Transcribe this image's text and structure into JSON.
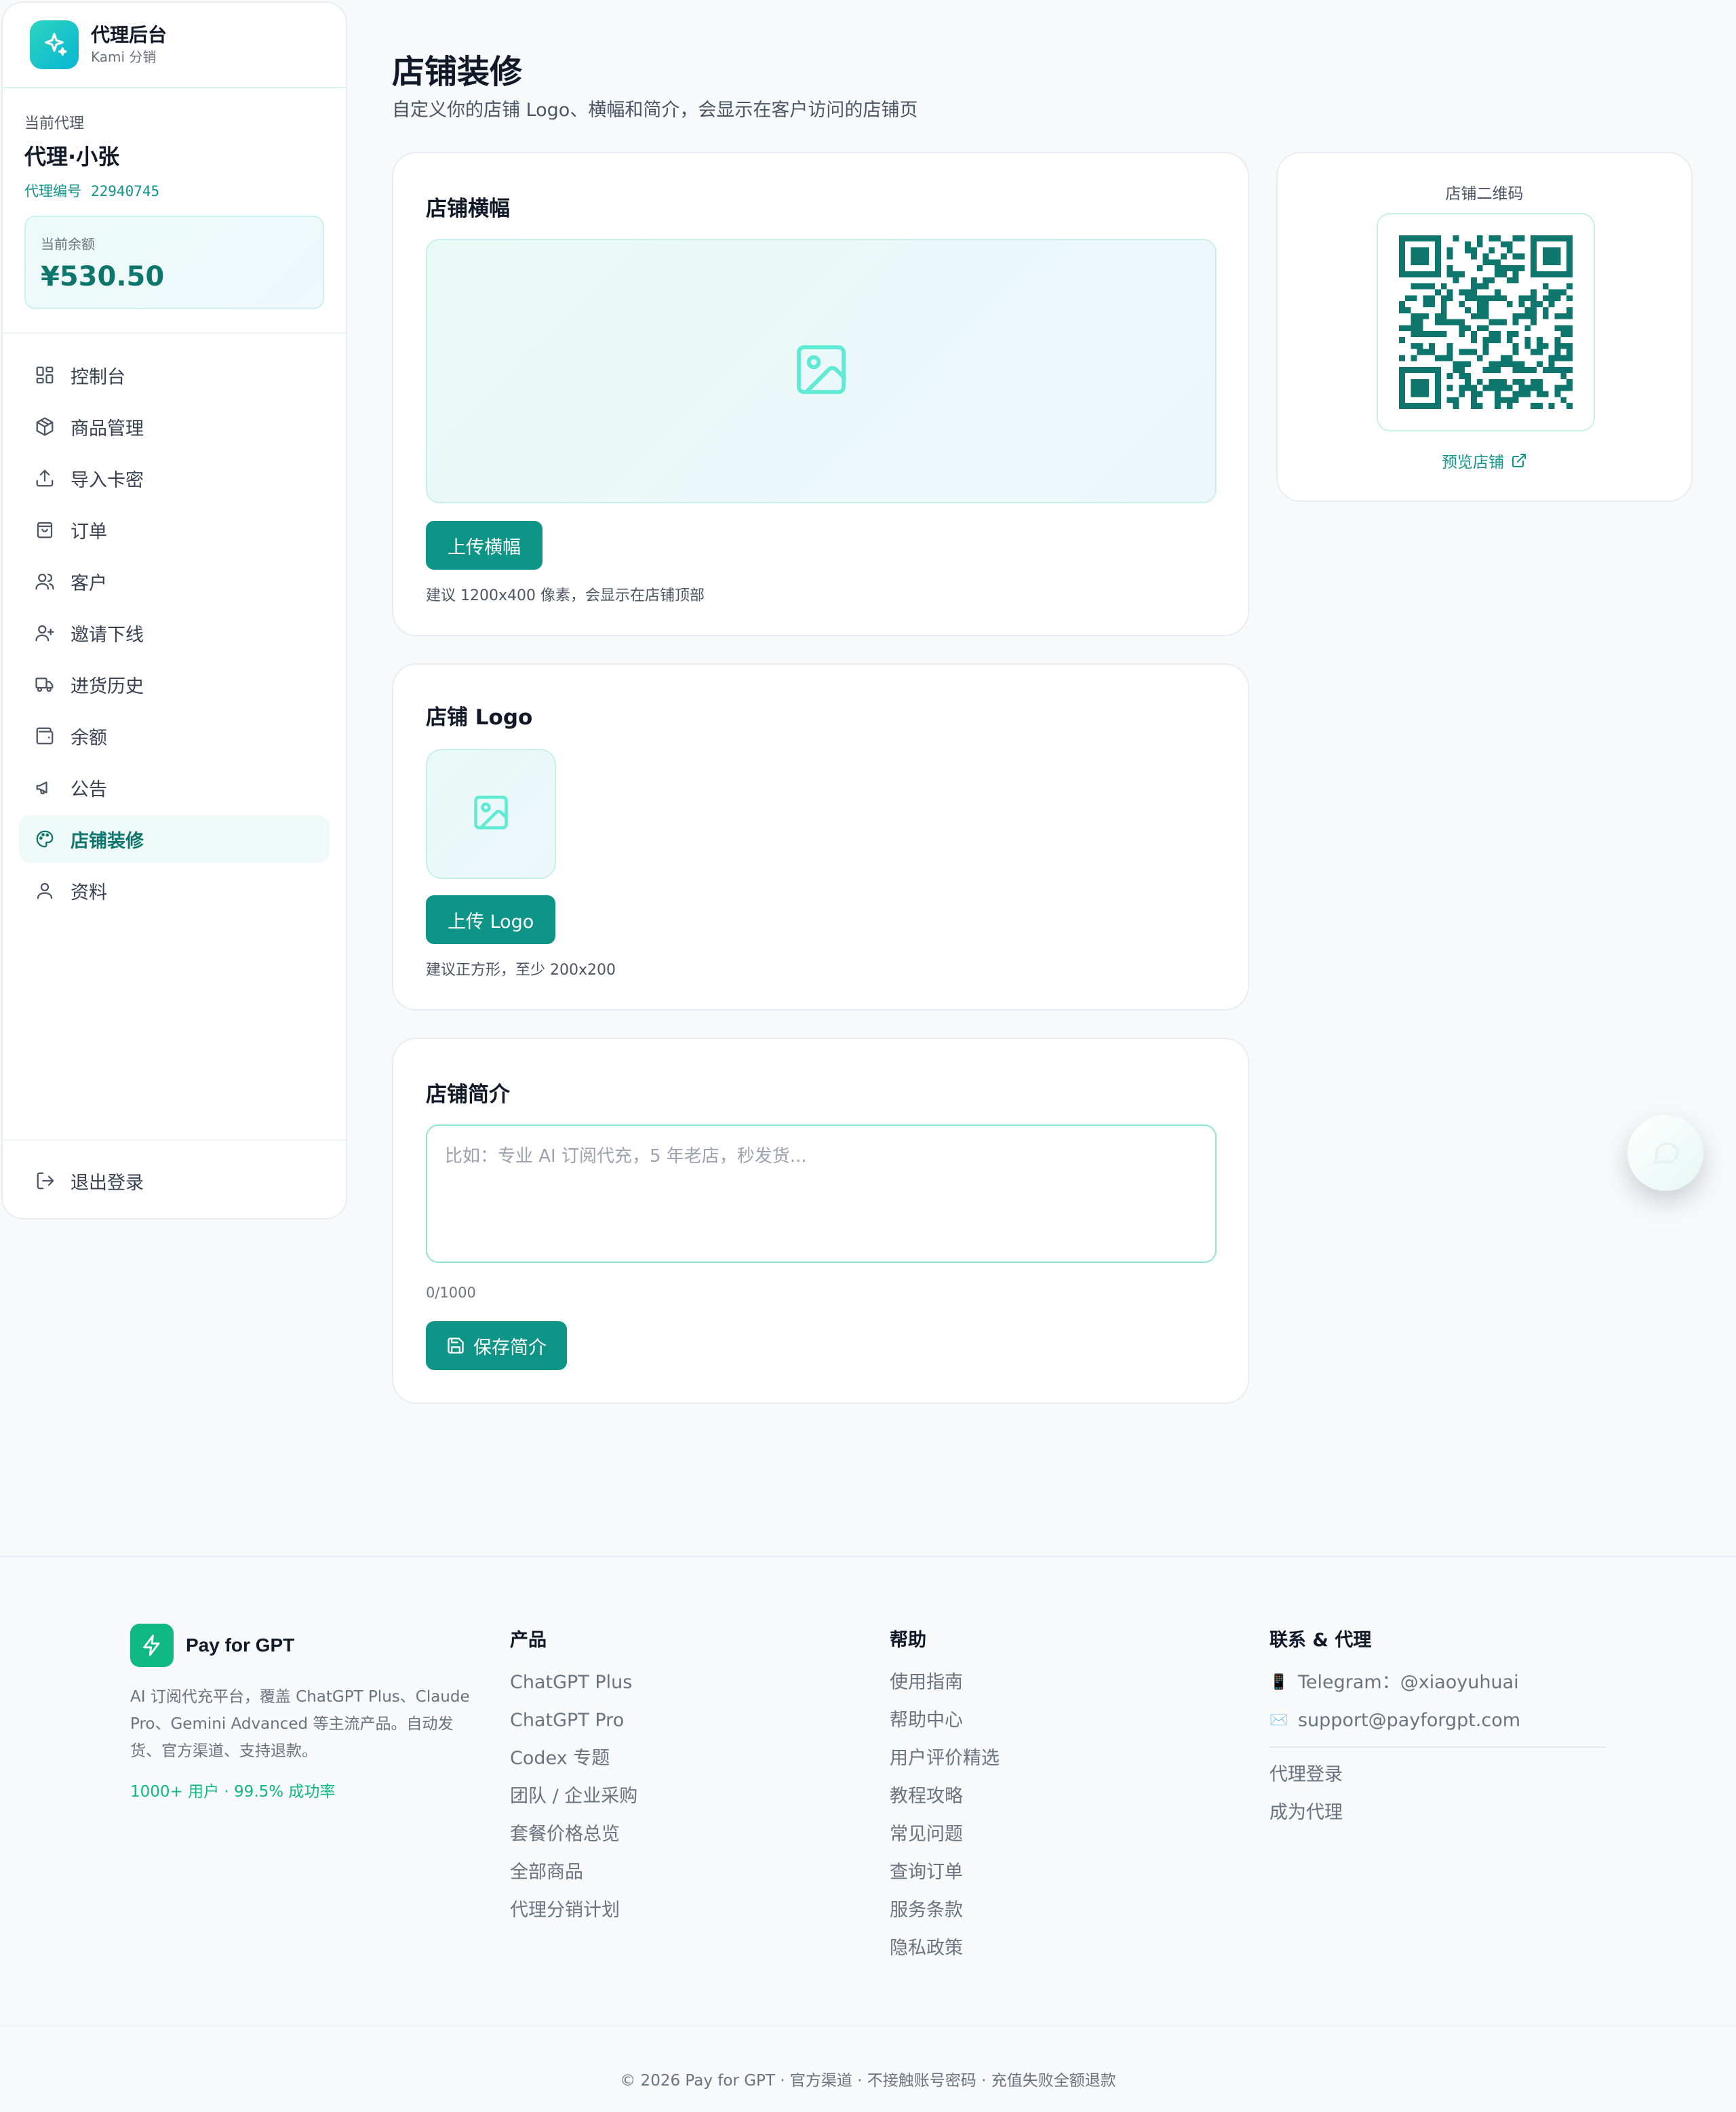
{
  "brand": {
    "title": "代理后台",
    "subtitle": "Kami 分销"
  },
  "agent": {
    "caption": "当前代理",
    "name": "代理·小张",
    "id_label": "代理编号",
    "id_value": "22940745",
    "balance_label": "当前余额",
    "balance_value": "¥530.50"
  },
  "nav": {
    "items": [
      {
        "label": "控制台",
        "icon": "dashboard-icon"
      },
      {
        "label": "商品管理",
        "icon": "package-icon"
      },
      {
        "label": "导入卡密",
        "icon": "upload-icon"
      },
      {
        "label": "订单",
        "icon": "shopping-bag-icon"
      },
      {
        "label": "客户",
        "icon": "users-icon"
      },
      {
        "label": "邀请下线",
        "icon": "user-plus-icon"
      },
      {
        "label": "进货历史",
        "icon": "truck-icon"
      },
      {
        "label": "余额",
        "icon": "wallet-icon"
      },
      {
        "label": "公告",
        "icon": "megaphone-icon"
      },
      {
        "label": "店铺装修",
        "icon": "palette-icon",
        "active": true
      },
      {
        "label": "资料",
        "icon": "user-icon"
      }
    ],
    "logout": "退出登录"
  },
  "page": {
    "title": "店铺装修",
    "description": "自定义你的店铺 Logo、横幅和简介，会显示在客户访问的店铺页"
  },
  "banner_card": {
    "title": "店铺横幅",
    "button": "上传横幅",
    "hint": "建议 1200x400 像素，会显示在店铺顶部"
  },
  "logo_card": {
    "title": "店铺 Logo",
    "button": "上传 Logo",
    "hint": "建议正方形，至少 200x200"
  },
  "intro_card": {
    "title": "店铺简介",
    "placeholder": "比如：专业 AI 订阅代充，5 年老店，秒发货...",
    "counter": "0/1000",
    "button": "保存简介"
  },
  "qr_card": {
    "label": "店铺二维码",
    "preview": "预览店铺"
  },
  "footer": {
    "brand": "Pay for GPT",
    "description": "AI 订阅代充平台，覆盖 ChatGPT Plus、Claude Pro、Gemini Advanced 等主流产品。自动发货、官方渠道、支持退款。",
    "stats": "1000+ 用户 · 99.5% 成功率",
    "products": {
      "title": "产品",
      "links": [
        "ChatGPT Plus",
        "ChatGPT Pro",
        "Codex 专题",
        "团队 / 企业采购",
        "套餐价格总览",
        "全部商品",
        "代理分销计划"
      ]
    },
    "help": {
      "title": "帮助",
      "links": [
        "使用指南",
        "帮助中心",
        "用户评价精选",
        "教程攻略",
        "常见问题",
        "查询订单",
        "服务条款",
        "隐私政策"
      ]
    },
    "contact": {
      "title": "联系 & 代理",
      "telegram": "Telegram：@xiaoyuhuai",
      "email": "support@payforgpt.com",
      "links": [
        "代理登录",
        "成为代理"
      ]
    },
    "copyright": "© 2026 Pay for GPT · 官方渠道 · 不接触账号密码 · 充值失败全额退款"
  },
  "colors": {
    "accent": "#0f9488",
    "accent_dark": "#0f766e",
    "brand_green": "#10b981"
  }
}
